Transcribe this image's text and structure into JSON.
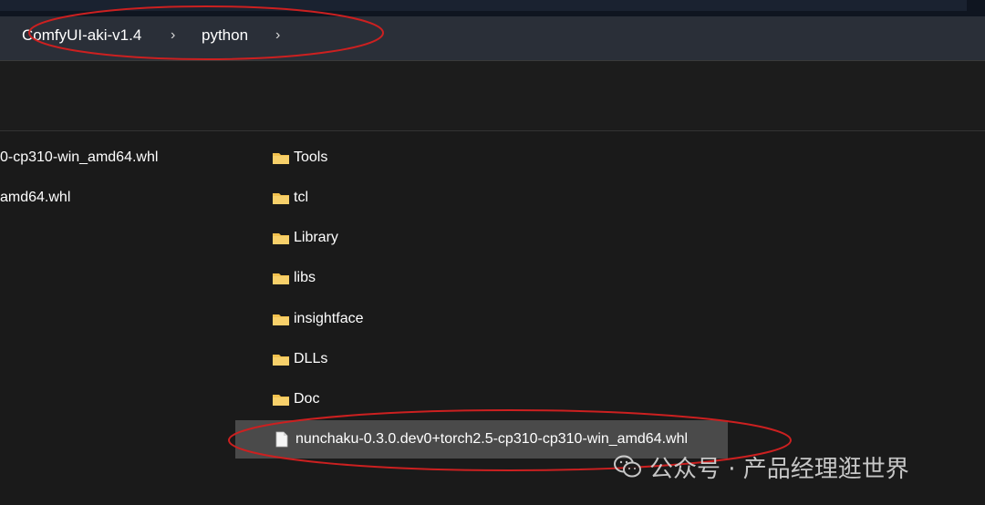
{
  "breadcrumb": {
    "items": [
      "ComfyUI-aki-v1.4",
      "python"
    ]
  },
  "left_column": {
    "items": [
      "0-cp310-win_amd64.whl",
      "amd64.whl"
    ]
  },
  "file_list": {
    "folders": [
      "Tools",
      "tcl",
      "Library",
      "libs",
      "insightface",
      "DLLs",
      "Doc"
    ],
    "selected_file": "nunchaku-0.3.0.dev0+torch2.5-cp310-cp310-win_amd64.whl"
  },
  "watermark": {
    "text": "公众号 · 产品经理逛世界"
  },
  "colors": {
    "annotation": "#cc2020",
    "folder": "#f2c14e",
    "selection": "#4a4a4a"
  }
}
